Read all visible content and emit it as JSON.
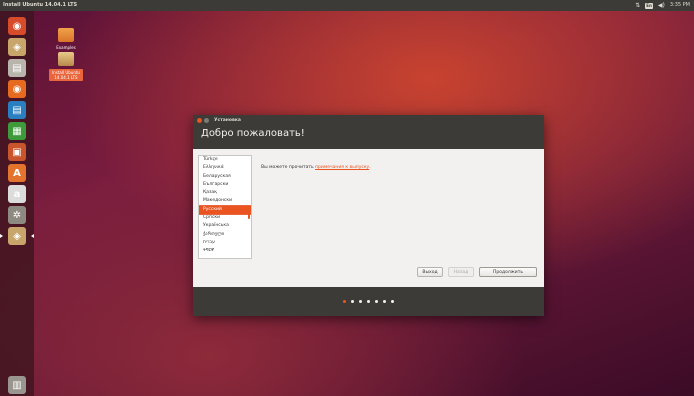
{
  "top_panel": {
    "title": "Install Ubuntu 14.04.1 LTS",
    "keyboard_indicator": "En",
    "time": "3:35 PM"
  },
  "launcher": {
    "items": [
      {
        "name": "dash-icon",
        "glyph": "◉",
        "color": "#d64b2a",
        "active": false
      },
      {
        "name": "installer-icon",
        "glyph": "◈",
        "color": "#c8a56a",
        "active": false
      },
      {
        "name": "files-icon",
        "glyph": "▤",
        "color": "#b9b5ad",
        "active": false
      },
      {
        "name": "firefox-icon",
        "glyph": "◉",
        "color": "#e66a1f",
        "active": false
      },
      {
        "name": "writer-icon",
        "glyph": "▤",
        "color": "#2a7fc1",
        "active": false
      },
      {
        "name": "calc-icon",
        "glyph": "▦",
        "color": "#3e9a3a",
        "active": false
      },
      {
        "name": "impress-icon",
        "glyph": "▣",
        "color": "#c9552c",
        "active": false
      },
      {
        "name": "software-center-icon",
        "glyph": "A",
        "color": "#e2742e",
        "active": false
      },
      {
        "name": "amazon-icon",
        "glyph": "a",
        "color": "#dcdcdc",
        "active": false
      },
      {
        "name": "settings-icon",
        "glyph": "✲",
        "color": "#8e8a82",
        "active": false
      },
      {
        "name": "installer-running-icon",
        "glyph": "◈",
        "color": "#c8a56a",
        "active": true
      },
      {
        "name": "trash-icon",
        "glyph": "▥",
        "color": "#9a968f",
        "active": false
      }
    ]
  },
  "desktop": {
    "examples_label": "Examples",
    "install_label_line1": "Install Ubuntu",
    "install_label_line2": "14.04.1 LTS"
  },
  "window": {
    "title": "Установка",
    "header": "Добро пожаловать!",
    "languages": [
      "Türkçe",
      "Ελληνικά",
      "Беларуская",
      "Български",
      "Қазақ",
      "Македонски",
      "Русский",
      "Српски",
      "Українська",
      "ქართული",
      "עברית",
      "ትግርኛ"
    ],
    "selected_language": "Русский",
    "info_text": "Вы можете прочитать ",
    "info_link": "примечания к выпуску",
    "info_end": ".",
    "buttons": {
      "quit": "Выход",
      "back": "Назад",
      "continue": "Продолжить"
    },
    "progress": {
      "total_steps": 7,
      "current_step": 1
    }
  },
  "colors": {
    "accent": "#e95420",
    "panel": "#3c3b37"
  }
}
